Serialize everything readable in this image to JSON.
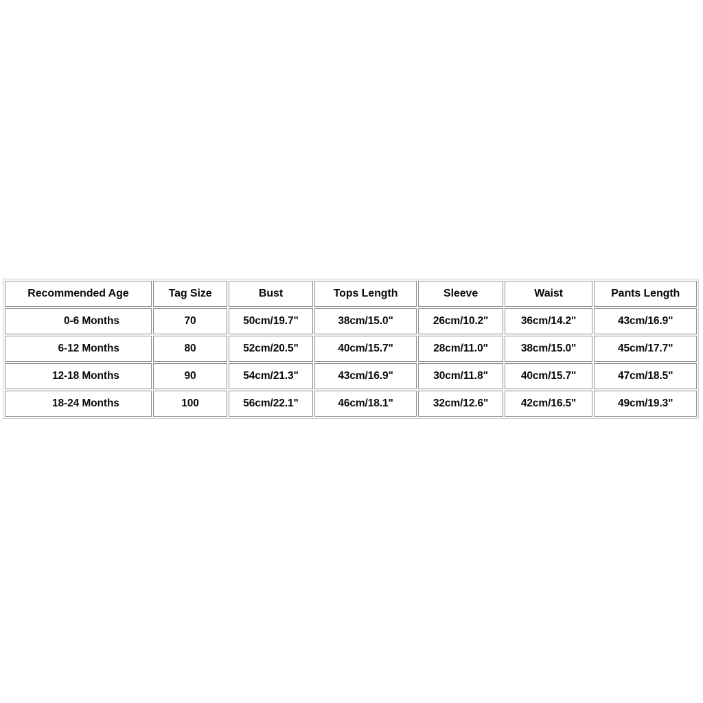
{
  "page": {
    "background_color": "#ffffff",
    "table_border_color": "#c9c9c9",
    "cell_border_color": "#8e8e8e",
    "text_color": "#0a0a0a"
  },
  "size_chart": {
    "headers": [
      "Recommended Age",
      "Tag Size",
      "Bust",
      "Tops Length",
      "Sleeve",
      "Waist",
      "Pants Length"
    ],
    "rows": [
      {
        "age": "0-6 Months",
        "tag_size": "70",
        "bust": "50cm/19.7\"",
        "tops_length": "38cm/15.0\"",
        "sleeve": "26cm/10.2\"",
        "waist": "36cm/14.2\"",
        "pants_length": "43cm/16.9\""
      },
      {
        "age": "6-12 Months",
        "tag_size": "80",
        "bust": "52cm/20.5\"",
        "tops_length": "40cm/15.7\"",
        "sleeve": "28cm/11.0\"",
        "waist": "38cm/15.0\"",
        "pants_length": "45cm/17.7\""
      },
      {
        "age": "12-18 Months",
        "tag_size": "90",
        "bust": "54cm/21.3\"",
        "tops_length": "43cm/16.9\"",
        "sleeve": "30cm/11.8\"",
        "waist": "40cm/15.7\"",
        "pants_length": "47cm/18.5\""
      },
      {
        "age": "18-24 Months",
        "tag_size": "100",
        "bust": "56cm/22.1\"",
        "tops_length": "46cm/18.1\"",
        "sleeve": "32cm/12.6\"",
        "waist": "42cm/16.5\"",
        "pants_length": "49cm/19.3\""
      }
    ]
  }
}
